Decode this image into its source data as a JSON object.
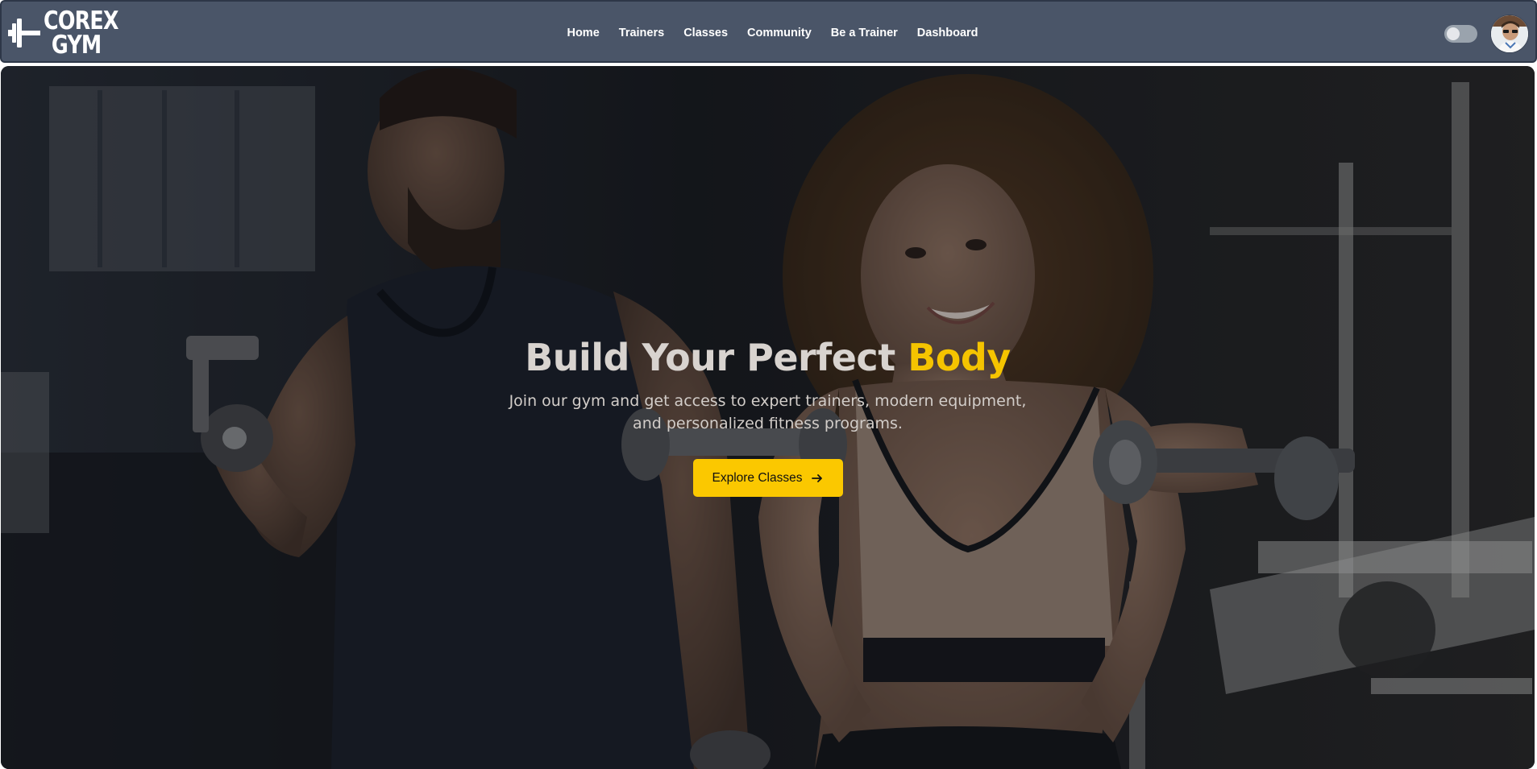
{
  "brand": {
    "line1": "COREX",
    "line2": "GYM"
  },
  "nav": {
    "links": [
      {
        "label": "Home"
      },
      {
        "label": "Trainers"
      },
      {
        "label": "Classes"
      },
      {
        "label": "Community"
      },
      {
        "label": "Be a Trainer"
      },
      {
        "label": "Dashboard"
      }
    ]
  },
  "theme_toggle": {
    "state": "off"
  },
  "user": {
    "avatar_icon": "user-avatar"
  },
  "hero": {
    "title_main": "Build Your Perfect ",
    "title_accent": "Body",
    "subtitle": "Join our gym and get access to expert trainers, modern equipment, and personalized fitness programs.",
    "cta_label": "Explore Classes",
    "cta_icon": "arrow-right-icon"
  },
  "colors": {
    "navbar_bg": "#4a5568",
    "accent": "#f5c400",
    "cta_bg": "#fbc800"
  }
}
